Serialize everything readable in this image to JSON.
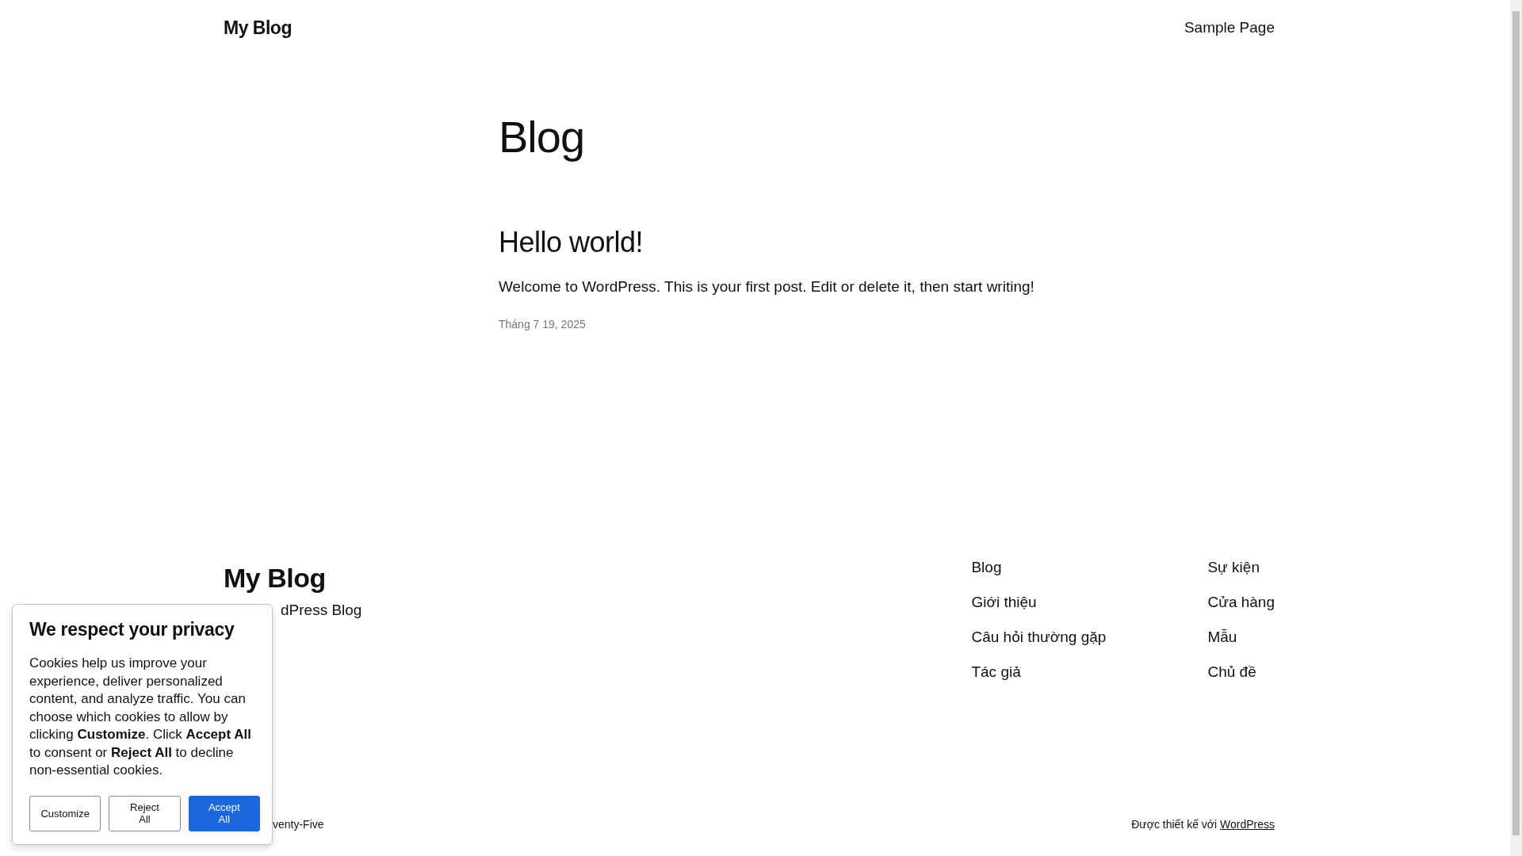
{
  "header": {
    "site_title": "My Blog",
    "nav": [
      "Sample Page"
    ]
  },
  "main": {
    "heading": "Blog",
    "posts": [
      {
        "title": "Hello world!",
        "excerpt": "Welcome to WordPress. This is your first post. Edit or delete it, then start writing!",
        "date": "Tháng 7 19, 2025"
      }
    ]
  },
  "footer": {
    "site_title": "My Blog",
    "tagline": "dPress Blog",
    "nav_columns": [
      [
        "Blog",
        "Giới thiệu",
        "Câu hỏi thường gặp",
        "Tác giả"
      ],
      [
        "Sự kiện",
        "Cửa hàng",
        "Mẫu",
        "Chủ đề"
      ]
    ],
    "credit_left": "venty-Five",
    "credit_right": "Được thiết kế với",
    "credit_link": "WordPress"
  },
  "cookie_banner": {
    "title": "We respect your privacy",
    "body": "Cookies help us improve your experience, deliver personalized content, and analyze traffic. You can choose which cookies to allow by clicking **Customize**. Click **Accept All** to consent or **Reject All** to decline non-essential cookies.",
    "buttons": [
      {
        "label": "Customize",
        "kind": "outline"
      },
      {
        "label": "Reject All",
        "kind": "outline"
      },
      {
        "label": "Accept All",
        "kind": "primary"
      }
    ]
  }
}
